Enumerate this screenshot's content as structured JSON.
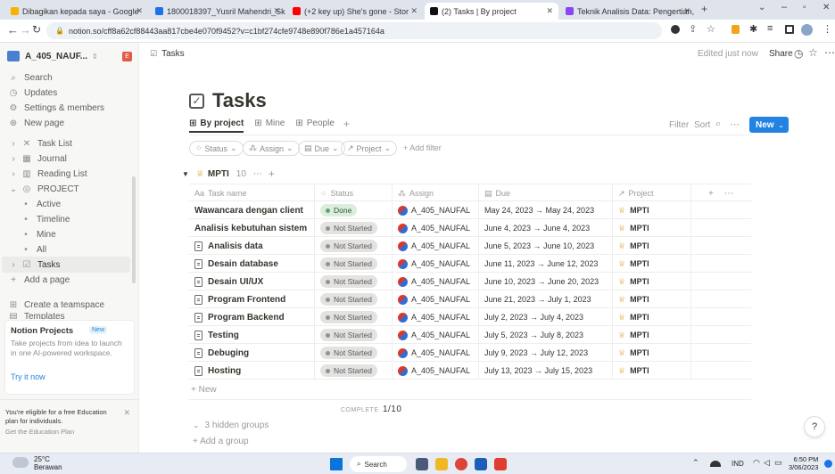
{
  "browser": {
    "tabs": [
      {
        "title": "Dibagikan kepada saya - Google",
        "color": "#f4b400"
      },
      {
        "title": "1800018397_Yusril Mahendri_Sk",
        "color": "#1a73e8"
      },
      {
        "title": "(+2 key up) She's gone - Stor",
        "color": "#ff0000"
      },
      {
        "title": "(2) Tasks | By project",
        "color": "#111111"
      },
      {
        "title": "Teknik Analisis Data: Pengertian,",
        "color": "#8b44f7"
      }
    ],
    "url": "notion.so/cff8a62cf88443aa817cbe4e070f9452?v=c1bf274cfe9748e890f786e1a457164a"
  },
  "sidebar": {
    "workspace": "A_405_NAUF...",
    "workspace_badge": "E",
    "top_items": [
      {
        "label": "Search",
        "icon": "search-icon"
      },
      {
        "label": "Updates",
        "icon": "clock-icon"
      },
      {
        "label": "Settings & members",
        "icon": "gear-icon"
      },
      {
        "label": "New page",
        "icon": "plus-circle-icon"
      }
    ],
    "tree": [
      {
        "label": "Task List",
        "icon": "x-tools-icon"
      },
      {
        "label": "Journal",
        "icon": "grid-icon"
      },
      {
        "label": "Reading List",
        "icon": "books-icon"
      },
      {
        "label": "PROJECT",
        "icon": "target-icon"
      },
      {
        "label": "Active",
        "icon": "bullet-icon"
      },
      {
        "label": "Timeline",
        "icon": "bullet-icon"
      },
      {
        "label": "Mine",
        "icon": "bullet-icon"
      },
      {
        "label": "All",
        "icon": "bullet-icon"
      },
      {
        "label": "Tasks",
        "icon": "checkbox-icon"
      }
    ],
    "add_page": "Add a page",
    "create_teamspace": "Create a teamspace",
    "templates": "Templates",
    "promo": {
      "title": "Notion Projects",
      "badge": "New",
      "text": "Take projects from idea to launch in one AI-powered workspace.",
      "link": "Try it now"
    },
    "edu": {
      "title": "You're eligible for a free Education plan for individuals.",
      "link": "Get the Education Plan"
    }
  },
  "header": {
    "breadcrumb": "Tasks",
    "edited": "Edited just now",
    "share": "Share"
  },
  "page": {
    "title": "Tasks",
    "views": [
      "By project",
      "Mine",
      "People"
    ],
    "filter": "Filter",
    "sort": "Sort",
    "new": "New",
    "filters": [
      "Status",
      "Assign",
      "Due",
      "Project"
    ],
    "add_filter": "+ Add filter"
  },
  "group": {
    "name": "MPTI",
    "count": "10",
    "columns": [
      "Task name",
      "Status",
      "Assign",
      "Due",
      "Project"
    ],
    "rows": [
      {
        "name": "Wawancara dengan client",
        "status": "Done",
        "assign": "A_405_NAUFAL",
        "due": "May 24, 2023 → May 24, 2023",
        "project": "MPTI",
        "page_icon": false
      },
      {
        "name": "Analisis kebutuhan sistem",
        "status": "Not Started",
        "assign": "A_405_NAUFAL",
        "due": "June 4, 2023 → June 4, 2023",
        "project": "MPTI",
        "page_icon": false
      },
      {
        "name": "Analisis data",
        "status": "Not Started",
        "assign": "A_405_NAUFAL",
        "due": "June 5, 2023 → June 10, 2023",
        "project": "MPTI",
        "page_icon": true
      },
      {
        "name": "Desain database",
        "status": "Not Started",
        "assign": "A_405_NAUFAL",
        "due": "June 11, 2023 → June 12, 2023",
        "project": "MPTI",
        "page_icon": true
      },
      {
        "name": "Desain UI/UX",
        "status": "Not Started",
        "assign": "A_405_NAUFAL",
        "due": "June 10, 2023 → June 20, 2023",
        "project": "MPTI",
        "page_icon": true
      },
      {
        "name": "Program Frontend",
        "status": "Not Started",
        "assign": "A_405_NAUFAL",
        "due": "June 21, 2023 → July 1, 2023",
        "project": "MPTI",
        "page_icon": true
      },
      {
        "name": "Program Backend",
        "status": "Not Started",
        "assign": "A_405_NAUFAL",
        "due": "July 2, 2023 → July 4, 2023",
        "project": "MPTI",
        "page_icon": true
      },
      {
        "name": "Testing",
        "status": "Not Started",
        "assign": "A_405_NAUFAL",
        "due": "July 5, 2023 → July 8, 2023",
        "project": "MPTI",
        "page_icon": true
      },
      {
        "name": "Debuging",
        "status": "Not Started",
        "assign": "A_405_NAUFAL",
        "due": "July 9, 2023 → July 12, 2023",
        "project": "MPTI",
        "page_icon": true
      },
      {
        "name": "Hosting",
        "status": "Not Started",
        "assign": "A_405_NAUFAL",
        "due": "July 13, 2023 → July 15, 2023",
        "project": "MPTI",
        "page_icon": true
      }
    ],
    "new_row": "+ New",
    "complete_label": "COMPLETE",
    "complete_value": "1/10",
    "hidden_groups": "3 hidden groups",
    "add_group": "+ Add a group"
  },
  "taskbar": {
    "weather_temp": "25°C",
    "weather_desc": "Berawan",
    "search": "Search",
    "lang": "IND",
    "time": "6:50 PM",
    "date": "3/06/2023"
  },
  "help": "?"
}
